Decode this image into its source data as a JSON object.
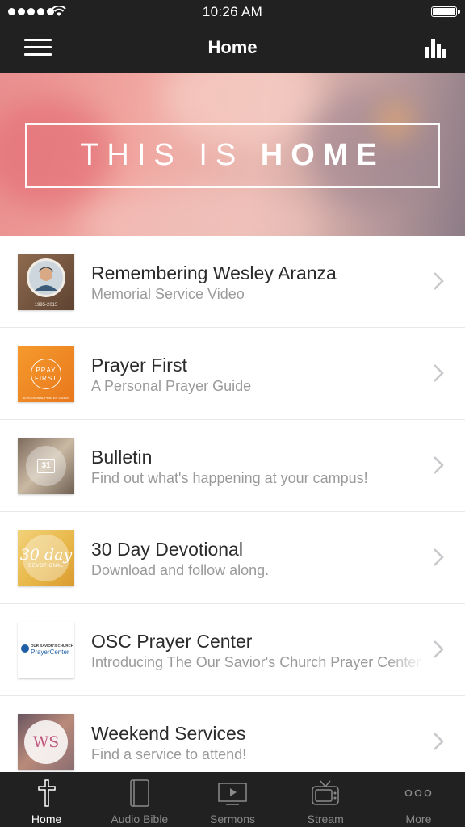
{
  "status_bar": {
    "time": "10:26 AM"
  },
  "nav": {
    "title": "Home"
  },
  "hero": {
    "text_light": "THIS IS ",
    "text_bold": "HOME"
  },
  "items": [
    {
      "title": "Remembering Wesley Aranza",
      "subtitle": "Memorial Service Video",
      "thumb_caption": "1995-2015"
    },
    {
      "title": "Prayer First",
      "subtitle": "A Personal Prayer Guide",
      "thumb_line1": "PRAY",
      "thumb_line2": "FIRST",
      "thumb_caption": "A PERSONAL PRAYER GUIDE"
    },
    {
      "title": "Bulletin",
      "subtitle": "Find out what's happening at your campus!",
      "thumb_text": "31"
    },
    {
      "title": "30 Day Devotional",
      "subtitle": "Download and follow along.",
      "thumb_line1": "30 day",
      "thumb_line2": "DEVOTIONAL"
    },
    {
      "title": "OSC Prayer Center",
      "subtitle": "Introducing The Our Savior's Church Prayer Center",
      "thumb_line1": "OUR SAVIOR'S CHURCH",
      "thumb_line2": "PrayerCenter"
    },
    {
      "title": "Weekend Services",
      "subtitle": "Find a service to attend!",
      "thumb_text": "WS"
    }
  ],
  "tabs": [
    {
      "label": "Home",
      "icon": "cross-icon",
      "active": true
    },
    {
      "label": "Audio Bible",
      "icon": "book-icon",
      "active": false
    },
    {
      "label": "Sermons",
      "icon": "play-screen-icon",
      "active": false
    },
    {
      "label": "Stream",
      "icon": "tv-icon",
      "active": false
    },
    {
      "label": "More",
      "icon": "more-dots-icon",
      "active": false
    }
  ],
  "colors": {
    "bar_bg": "#212121",
    "active_tab": "#ffffff",
    "inactive_tab": "#8a8a8a"
  }
}
